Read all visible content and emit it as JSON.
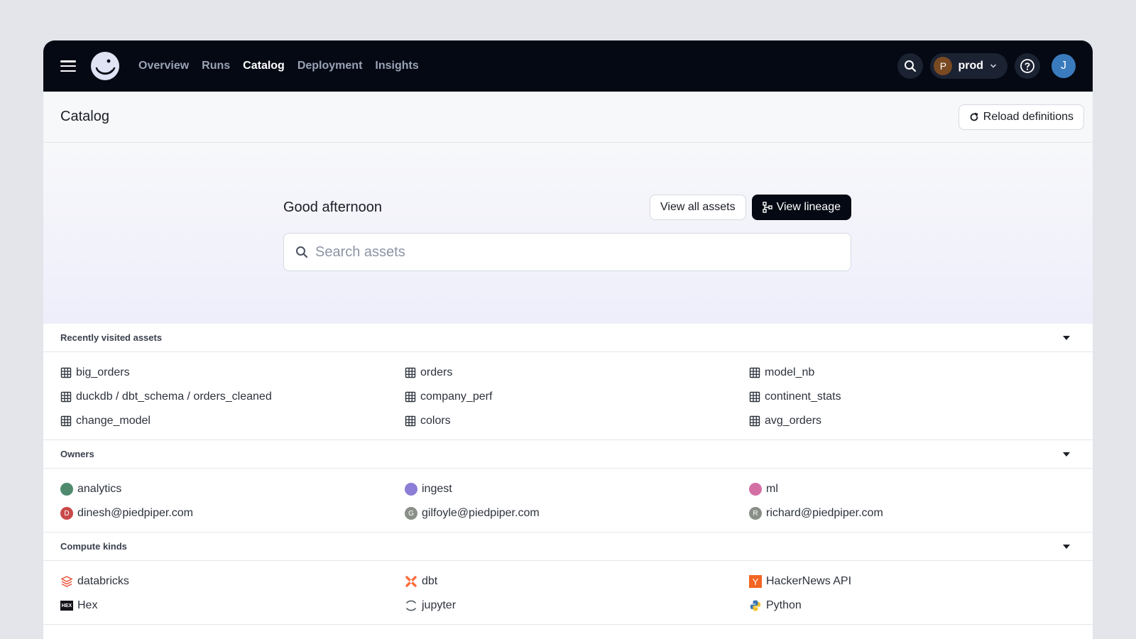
{
  "nav": {
    "links": [
      "Overview",
      "Runs",
      "Catalog",
      "Deployment",
      "Insights"
    ],
    "active": "Catalog",
    "deployment": {
      "initial": "P",
      "name": "prod"
    },
    "user_initial": "J"
  },
  "header": {
    "title": "Catalog",
    "reload_label": "Reload definitions"
  },
  "hero": {
    "greeting": "Good afternoon",
    "view_all_label": "View all assets",
    "view_lineage_label": "View lineage",
    "search_placeholder": "Search assets"
  },
  "recent": {
    "title": "Recently visited assets",
    "items": [
      "big_orders",
      "orders",
      "model_nb",
      "duckdb / dbt_schema / orders_cleaned",
      "company_perf",
      "continent_stats",
      "change_model",
      "colors",
      "avg_orders"
    ]
  },
  "owners": {
    "title": "Owners",
    "items": [
      {
        "label": "analytics",
        "color": "#4f8a6e",
        "initial": ""
      },
      {
        "label": "ingest",
        "color": "#8c7ed6",
        "initial": ""
      },
      {
        "label": "ml",
        "color": "#d46fa6",
        "initial": ""
      },
      {
        "label": "dinesh@piedpiper.com",
        "color": "#c94a4a",
        "initial": "D"
      },
      {
        "label": "gilfoyle@piedpiper.com",
        "color": "#8a8f88",
        "initial": "G"
      },
      {
        "label": "richard@piedpiper.com",
        "color": "#8a8f88",
        "initial": "R"
      }
    ]
  },
  "compute": {
    "title": "Compute kinds",
    "items": [
      {
        "label": "databricks",
        "icon": "databricks-icon"
      },
      {
        "label": "dbt",
        "icon": "dbt-icon"
      },
      {
        "label": "HackerNews API",
        "icon": "hackernews-icon",
        "glyph": "Y"
      },
      {
        "label": "Hex",
        "icon": "hex-icon",
        "glyph": "HEX"
      },
      {
        "label": "jupyter",
        "icon": "jupyter-icon"
      },
      {
        "label": "Python",
        "icon": "python-icon"
      }
    ]
  }
}
